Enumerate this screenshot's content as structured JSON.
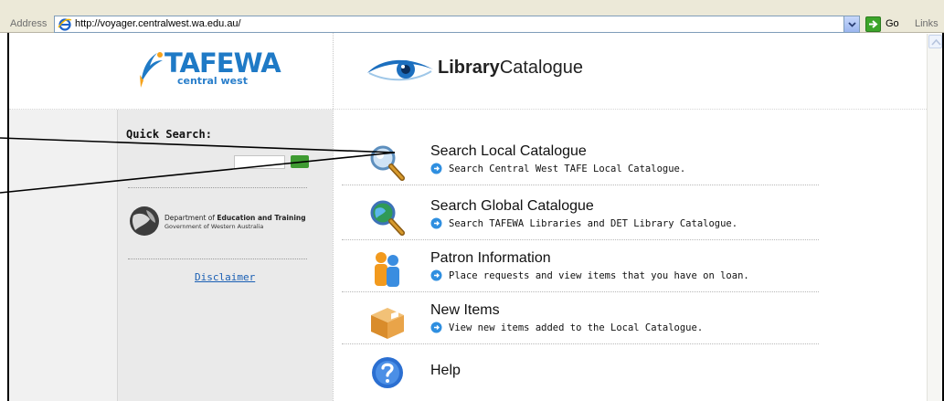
{
  "browser": {
    "address_label": "Address",
    "url": "http://voyager.centralwest.wa.edu.au/",
    "go_label": "Go",
    "links_label": "Links"
  },
  "header": {
    "tafe_logo_word": "TAFEWA",
    "tafe_logo_sub": "central west",
    "library_logo_bold": "Library",
    "library_logo_rest": "Catalogue"
  },
  "sidebar": {
    "quick_search_label": "Quick Search:",
    "det_logo_line1_prefix": "Department of ",
    "det_logo_line1_bold": "Education and Training",
    "det_logo_line2": "Government of Western Australia",
    "disclaimer_link": "Disclaimer"
  },
  "menu": [
    {
      "title": "Search Local Catalogue",
      "desc": "Search Central West TAFE Local Catalogue.",
      "icon": "magnifier-icon"
    },
    {
      "title": "Search Global Catalogue",
      "desc": "Search TAFEWA Libraries and DET Library Catalogue.",
      "icon": "globe-magnifier-icon"
    },
    {
      "title": "Patron Information",
      "desc": "Place requests and view items that you have on loan.",
      "icon": "patron-people-icon"
    },
    {
      "title": "New Items",
      "desc": "View new items added to the Local Catalogue.",
      "icon": "new-items-box-icon"
    },
    {
      "title": "Help",
      "desc": "",
      "icon": "help-question-icon"
    }
  ],
  "colors": {
    "tafe_blue": "#1f7ac6",
    "link_blue": "#1a5fb4",
    "go_green": "#3ca52a",
    "sidebar_grey": "#eaeaea"
  }
}
